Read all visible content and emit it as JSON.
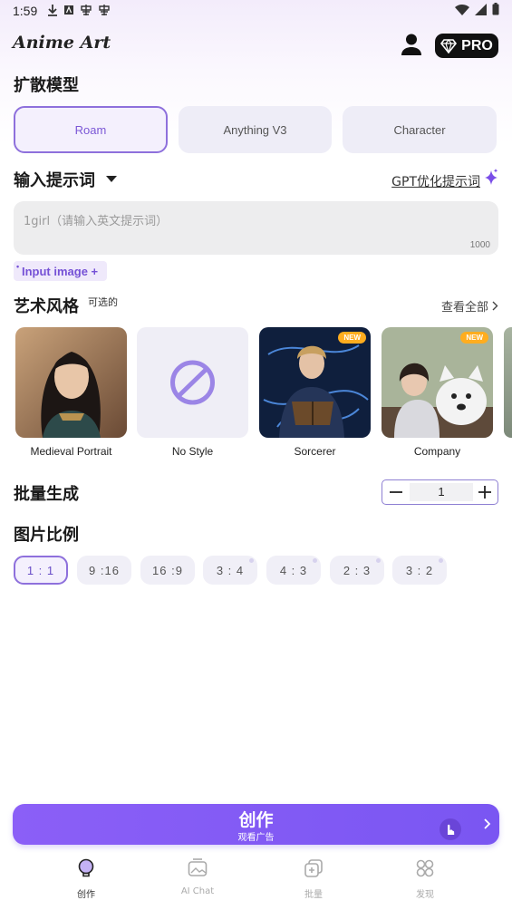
{
  "status_bar": {
    "time": "1:59",
    "left_icons": [
      "download-icon",
      "a-icon",
      "app-icon",
      "app-icon"
    ],
    "right_icons": [
      "wifi-icon",
      "signal-icon",
      "battery-icon"
    ]
  },
  "header": {
    "title": "Anime Art",
    "pro_label": "PRO"
  },
  "model_section": {
    "title": "扩散模型",
    "options": [
      {
        "label": "Roam",
        "selected": true
      },
      {
        "label": "Anything V3",
        "selected": false
      },
      {
        "label": "Character",
        "selected": false
      }
    ]
  },
  "prompt": {
    "label": "输入提示词",
    "gpt_link": "GPT优化提示词",
    "placeholder": "1girl（请输入英文提示词）",
    "max_chars": "1000",
    "input_image_label": "Input image +"
  },
  "styles": {
    "title": "艺术风格",
    "subtitle": "可选的",
    "view_all": "查看全部",
    "badge": "NEW",
    "items": [
      {
        "name": "Medieval Portrait",
        "new": false
      },
      {
        "name": "No Style",
        "new": false
      },
      {
        "name": "Sorcerer",
        "new": true
      },
      {
        "name": "Company",
        "new": true
      }
    ]
  },
  "batch": {
    "title": "批量生成",
    "value": "1"
  },
  "ratio": {
    "title": "图片比例",
    "options": [
      {
        "label": "1 : 1",
        "selected": true,
        "locked": false
      },
      {
        "label": "9 :16",
        "selected": false,
        "locked": false
      },
      {
        "label": "16 :9",
        "selected": false,
        "locked": false
      },
      {
        "label": "3 : 4",
        "selected": false,
        "locked": true
      },
      {
        "label": "4 : 3",
        "selected": false,
        "locked": true
      },
      {
        "label": "2 : 3",
        "selected": false,
        "locked": true
      },
      {
        "label": "3 : 2",
        "selected": false,
        "locked": true
      }
    ]
  },
  "create_button": {
    "label": "创作",
    "sublabel": "观看广告"
  },
  "bottom_nav": [
    {
      "label": "创作",
      "icon": "bulb-icon",
      "active": true
    },
    {
      "label": "AI Chat",
      "icon": "image-chat-icon",
      "active": false
    },
    {
      "label": "批量",
      "icon": "batch-icon",
      "active": false
    },
    {
      "label": "发现",
      "icon": "discover-icon",
      "active": false
    }
  ],
  "colors": {
    "accent": "#7b57d6",
    "button_gradient_start": "#8b5ff7",
    "button_gradient_end": "#7a56f2",
    "new_badge": "#ffad1f"
  }
}
